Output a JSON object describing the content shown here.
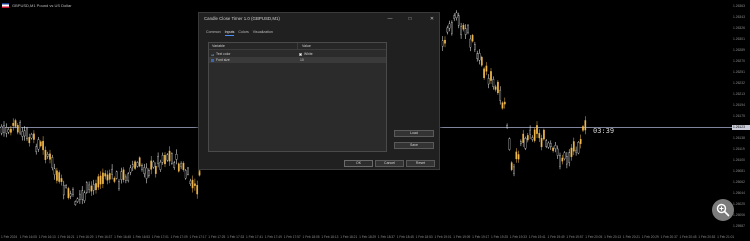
{
  "chart": {
    "symbol_line": "GBPUSD,M1  Pound vs US Dollar",
    "timer": "03:39",
    "current_price": "1.26123",
    "price_labels": [
      "1.26363",
      "1.26343",
      "1.26326",
      "1.26301",
      "1.26289",
      "1.26270",
      "1.26251",
      "1.26232",
      "1.26213",
      "1.26194",
      "1.26175",
      "1.26157",
      "1.26138",
      "1.26119",
      "1.26100",
      "1.26081",
      "1.26062",
      "1.26044",
      "1.26025",
      "1.26006",
      "1.25987"
    ],
    "time_labels": [
      "1 Feb 2024",
      "1 Feb 16:05",
      "1 Feb 16:13",
      "1 Feb 16:21",
      "1 Feb 16:29",
      "1 Feb 16:37",
      "1 Feb 16:45",
      "1 Feb 16:53",
      "1 Feb 17:01",
      "1 Feb 17:09",
      "1 Feb 17:17",
      "1 Feb 17:25",
      "1 Feb 17:33",
      "1 Feb 17:41",
      "1 Feb 17:49",
      "1 Feb 17:57",
      "1 Feb 18:05",
      "1 Feb 18:13",
      "1 Feb 18:21",
      "1 Feb 18:29",
      "1 Feb 18:37",
      "1 Feb 18:45",
      "1 Feb 18:53",
      "1 Feb 19:01",
      "1 Feb 19:09",
      "1 Feb 19:17",
      "1 Feb 19:25",
      "1 Feb 19:33",
      "1 Feb 19:41",
      "1 Feb 19:49",
      "1 Feb 19:57",
      "1 Feb 20:05",
      "1 Feb 20:13",
      "1 Feb 20:21",
      "1 Feb 20:29",
      "1 Feb 20:37",
      "1 Feb 20:45",
      "1 Feb 20:53",
      "1 Feb 21:01"
    ],
    "colors": {
      "bull": "#f2b84b",
      "bear": "#ffffff",
      "price_line": "#a7b0d0",
      "grid": "#111111"
    }
  },
  "dialog": {
    "title": "Candle Close Timer 1.0 (GBPUSD,M1)",
    "tabs": [
      "Common",
      "Inputs",
      "Colors",
      "Visualization"
    ],
    "active_tab": 1,
    "grid": {
      "headers": {
        "variable": "Variable",
        "value": "Value"
      },
      "rows": [
        {
          "name": "Text color",
          "value": "White",
          "icon": "text-icon"
        },
        {
          "name": "Font size",
          "value": "10",
          "icon": "number-icon"
        }
      ]
    },
    "buttons": {
      "load": "Load",
      "save": "Save",
      "ok": "OK",
      "cancel": "Cancel",
      "reset": "Reset"
    },
    "window_controls": {
      "minimize": "—",
      "maximize": "□",
      "close": "✕"
    }
  }
}
